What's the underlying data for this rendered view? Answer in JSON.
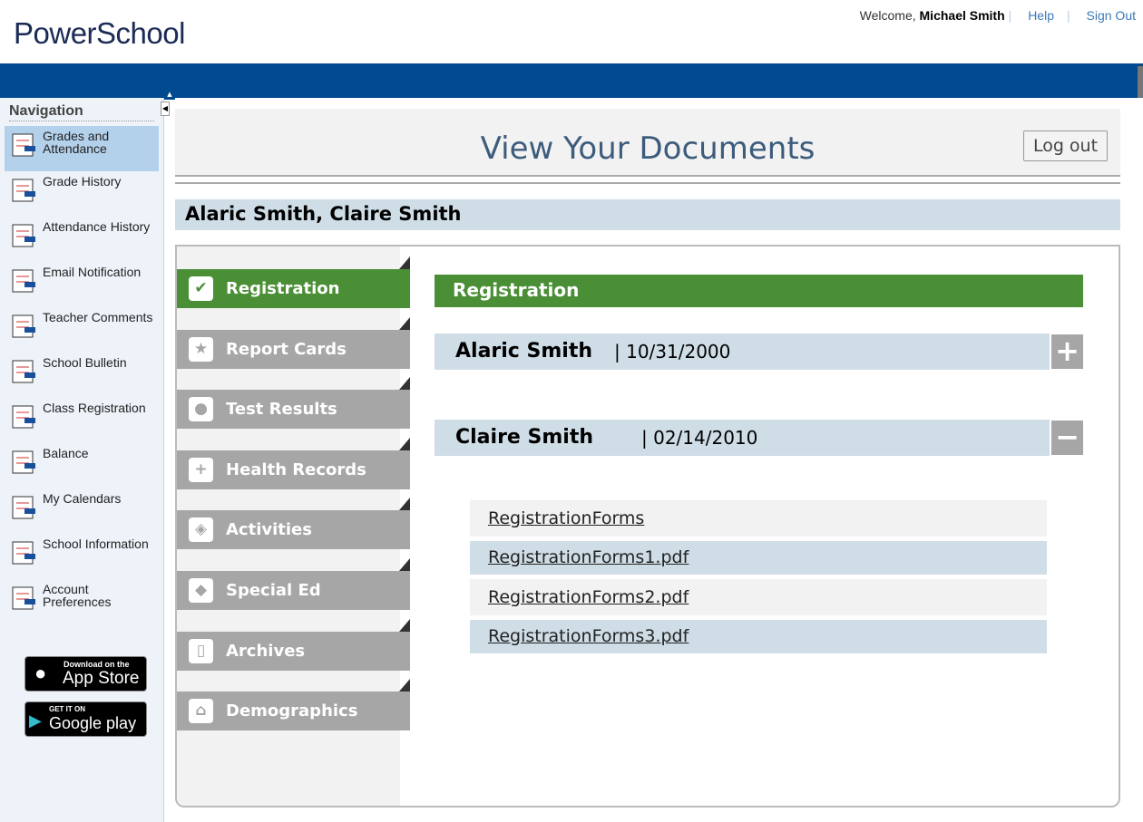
{
  "header": {
    "logo": "PowerSchool",
    "welcome": "Welcome,",
    "user": "Michael Smith",
    "help": "Help",
    "signout": "Sign Out"
  },
  "sidebar": {
    "title": "Navigation",
    "items": [
      {
        "label": "Grades and Attendance",
        "icon": "grades-icon"
      },
      {
        "label": "Grade History",
        "icon": "grade-history-icon"
      },
      {
        "label": "Attendance History",
        "icon": "attendance-history-icon"
      },
      {
        "label": "Email Notification",
        "icon": "email-icon"
      },
      {
        "label": "Teacher Comments",
        "icon": "comments-icon"
      },
      {
        "label": "School Bulletin",
        "icon": "bulletin-icon"
      },
      {
        "label": "Class Registration",
        "icon": "class-registration-icon"
      },
      {
        "label": "Balance",
        "icon": "balance-icon"
      },
      {
        "label": "My Calendars",
        "icon": "calendar-icon"
      },
      {
        "label": "School Information",
        "icon": "school-icon"
      },
      {
        "label": "Account Preferences",
        "icon": "preferences-icon"
      }
    ],
    "appstore": {
      "small": "Download on the",
      "big": "App Store"
    },
    "googleplay": {
      "small": "GET IT ON",
      "big": "Google play"
    }
  },
  "main": {
    "title": "View Your Documents",
    "logout": "Log out",
    "students": "Alaric Smith, Claire Smith",
    "tabs": [
      {
        "label": "Registration",
        "glyph": "✔"
      },
      {
        "label": "Report Cards",
        "glyph": "★"
      },
      {
        "label": "Test Results",
        "glyph": "●"
      },
      {
        "label": "Health Records",
        "glyph": "+"
      },
      {
        "label": "Activities",
        "glyph": "◈"
      },
      {
        "label": "Special Ed",
        "glyph": "◆"
      },
      {
        "label": "Archives",
        "glyph": "▯"
      },
      {
        "label": "Demographics",
        "glyph": "⌂"
      }
    ],
    "section": "Registration",
    "people": [
      {
        "name": "Alaric Smith",
        "dob": "| 10/31/2000",
        "toggle": "+"
      },
      {
        "name": "Claire Smith",
        "dob": "| 02/14/2010",
        "toggle": "−"
      }
    ],
    "docs": [
      "RegistrationForms",
      "RegistrationForms1.pdf",
      "RegistrationForms2.pdf",
      "RegistrationForms3.pdf"
    ]
  },
  "colors": {
    "brand": "#004a8f",
    "active_tab": "#4a8f36",
    "row": "#cfdde7"
  }
}
